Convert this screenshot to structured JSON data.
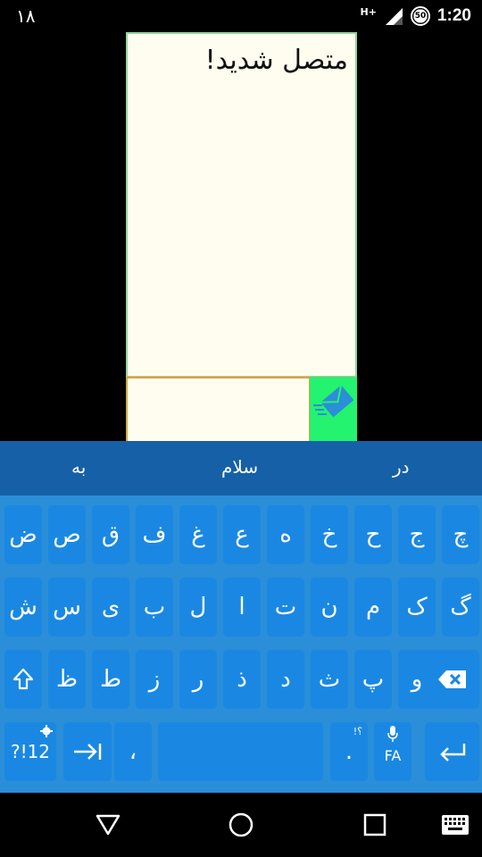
{
  "status_bar": {
    "left_text": "۱۸",
    "network_type": "H+",
    "battery_level": "50",
    "time": "1:20"
  },
  "chat": {
    "message": "متصل شدید!",
    "send_icon": "envelope-send-icon"
  },
  "suggestions": [
    "به",
    "سلام",
    "در"
  ],
  "keyboard": {
    "row1": [
      "ض",
      "ص",
      "ق",
      "ف",
      "غ",
      "ع",
      "ه",
      "خ",
      "ح",
      "ج",
      "چ"
    ],
    "row2": [
      "ش",
      "س",
      "ی",
      "ب",
      "ل",
      "ا",
      "ت",
      "ن",
      "م",
      "ک",
      "گ"
    ],
    "row3_letters": [
      "ظ",
      "ط",
      "ز",
      "ر",
      "ذ",
      "د",
      "ث",
      "پ",
      "و"
    ],
    "shift_icon": "shift-icon",
    "backspace_icon": "backspace-icon",
    "symbols_label": "?!12",
    "tab_icon": "tab-icon",
    "comma_label": "،",
    "period_label": ".",
    "period_hint": "!؟",
    "lang_label": "FA",
    "enter_icon": "enter-icon"
  },
  "nav_bar": {
    "back_icon": "back-icon",
    "home_icon": "home-icon",
    "recents_icon": "recents-icon",
    "keyboard_icon": "keyboard-switch-icon"
  },
  "colors": {
    "keyboard_bg": "#2a8ed9",
    "key_bg": "#1a88e2",
    "suggestion_bg": "#1660a8",
    "chat_bg": "#fefdef",
    "send_bg": "#23f36f"
  }
}
